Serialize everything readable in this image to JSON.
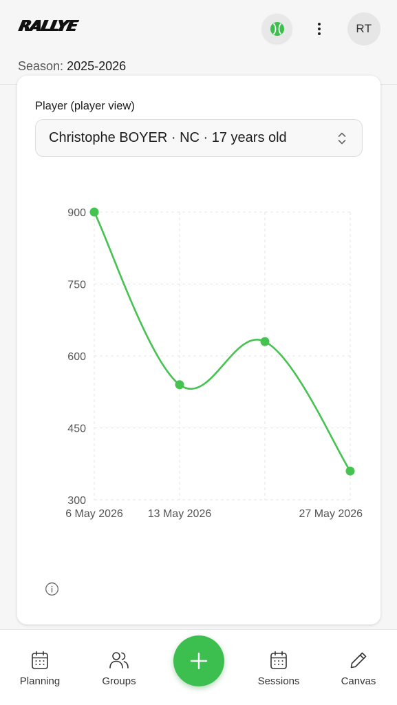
{
  "header": {
    "logo_text": "RALLYE",
    "avatar_initials": "RT",
    "season_label": "Season:",
    "season_value": "2025-2026",
    "icons": {
      "sport": "tennis-ball-icon",
      "menu": "kebab-menu-icon"
    }
  },
  "player_picker": {
    "label": "Player (player view)",
    "selected": "Christophe BOYER · NC · 17 years old"
  },
  "chart_data": {
    "type": "line",
    "x": [
      "6 May 2026",
      "13 May 2026",
      "20 May 2026",
      "27 May 2026"
    ],
    "x_tick_labels": [
      "6 May 2026",
      "13 May 2026",
      "27 May 2026"
    ],
    "values": [
      900,
      540,
      630,
      360
    ],
    "yticks": [
      "900",
      "750",
      "600",
      "450",
      "300"
    ],
    "ylim": [
      300,
      900
    ],
    "grid": true,
    "line_color": "#45c24f",
    "curve": "smooth"
  },
  "bottom_nav": {
    "items": [
      {
        "label": "Planning",
        "icon": "calendar-icon"
      },
      {
        "label": "Groups",
        "icon": "users-icon"
      },
      {
        "label": "Sessions",
        "icon": "calendar-icon"
      },
      {
        "label": "Canvas",
        "icon": "pencil-icon"
      }
    ],
    "fab_icon": "plus-icon"
  },
  "colors": {
    "accent": "#3dbf4f",
    "background": "#f6f6f6",
    "card": "#ffffff"
  }
}
